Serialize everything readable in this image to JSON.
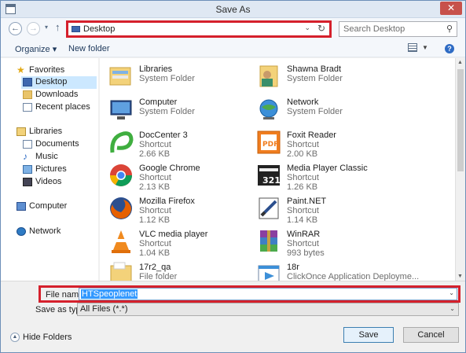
{
  "window": {
    "title": "Save As",
    "close_glyph": "✕"
  },
  "nav": {
    "back_glyph": "←",
    "forward_glyph": "→",
    "recent_glyph": "▾",
    "up_glyph": "↑",
    "address": "Desktop",
    "address_drop_glyph": "⌄",
    "refresh_glyph": "↻",
    "search_placeholder": "Search Desktop",
    "search_glyph": "⚲"
  },
  "toolbar": {
    "organize": "Organize ▾",
    "new_folder": "New folder",
    "view_drop_glyph": "▼",
    "help_glyph": "?"
  },
  "sidebar": {
    "items": [
      {
        "label": "Favorites",
        "icon": "star-icon"
      },
      {
        "label": "Desktop",
        "icon": "desktop-icon"
      },
      {
        "label": "Downloads",
        "icon": "downloads-icon"
      },
      {
        "label": "Recent places",
        "icon": "recent-places-icon"
      },
      {
        "label": "Libraries",
        "icon": "libraries-icon"
      },
      {
        "label": "Documents",
        "icon": "documents-icon"
      },
      {
        "label": "Music",
        "icon": "music-icon"
      },
      {
        "label": "Pictures",
        "icon": "pictures-icon"
      },
      {
        "label": "Videos",
        "icon": "videos-icon"
      },
      {
        "label": "Computer",
        "icon": "computer-icon"
      },
      {
        "label": "Network",
        "icon": "network-icon"
      }
    ],
    "music_glyph": "♪",
    "star_glyph": "★"
  },
  "files": [
    {
      "name": "Libraries",
      "type": "System Folder",
      "size": "",
      "icon": "libraries-folder-icon"
    },
    {
      "name": "Shawna Bradt",
      "type": "System Folder",
      "size": "",
      "icon": "user-folder-icon"
    },
    {
      "name": "Computer",
      "type": "System Folder",
      "size": "",
      "icon": "computer-icon"
    },
    {
      "name": "Network",
      "type": "System Folder",
      "size": "",
      "icon": "network-globe-icon"
    },
    {
      "name": "DocCenter 3",
      "type": "Shortcut",
      "size": "2.66 KB",
      "icon": "doccenter-icon"
    },
    {
      "name": "Foxit Reader",
      "type": "Shortcut",
      "size": "2.00 KB",
      "icon": "pdf-icon"
    },
    {
      "name": "Google Chrome",
      "type": "Shortcut",
      "size": "2.13 KB",
      "icon": "chrome-icon"
    },
    {
      "name": "Media Player Classic",
      "type": "Shortcut",
      "size": "1.26 KB",
      "icon": "media-player-icon"
    },
    {
      "name": "Mozilla Firefox",
      "type": "Shortcut",
      "size": "1.12 KB",
      "icon": "firefox-icon"
    },
    {
      "name": "Paint.NET",
      "type": "Shortcut",
      "size": "1.14 KB",
      "icon": "paint-net-icon"
    },
    {
      "name": "VLC media player",
      "type": "Shortcut",
      "size": "1.04 KB",
      "icon": "vlc-cone-icon"
    },
    {
      "name": "WinRAR",
      "type": "Shortcut",
      "size": "993 bytes",
      "icon": "winrar-icon"
    },
    {
      "name": "17r2_qa",
      "type": "File folder",
      "size": "",
      "icon": "folder-icon"
    },
    {
      "name": "18r",
      "type": "ClickOnce Application Deployme...",
      "size": "",
      "icon": "clickonce-icon"
    }
  ],
  "bottom": {
    "file_name_label": "File name:",
    "file_name_value": "HTSpeoplenet",
    "save_as_type_label": "Save as type:",
    "save_as_type_value": "All Files (*.*)",
    "dropdown_glyph": "⌄",
    "hide_folders_label": "Hide Folders",
    "hide_folders_glyph": "▲",
    "save_label": "Save",
    "cancel_label": "Cancel"
  },
  "scrollbar": {
    "up_glyph": "▲",
    "down_glyph": "▼"
  },
  "colors": {
    "highlight_border": "#d5202c",
    "selection": "#3399ff",
    "sidebar_selected": "#cce8ff",
    "close_button": "#c7514b"
  }
}
